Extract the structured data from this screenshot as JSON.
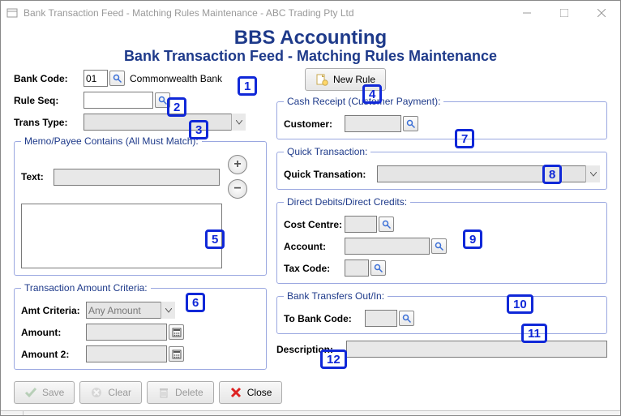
{
  "window": {
    "title": "Bank Transaction Feed - Matching Rules Maintenance - ABC Trading Pty Ltd"
  },
  "headings": {
    "h1": "BBS Accounting",
    "h2": "Bank Transaction Feed - Matching Rules Maintenance"
  },
  "left": {
    "bankCodeLabel": "Bank Code:",
    "bankCodeValue": "01",
    "bankName": "Commonwealth Bank",
    "ruleSeqLabel": "Rule Seq:",
    "transTypeLabel": "Trans Type:",
    "memoLegend": "Memo/Payee Contains (All Must Match):",
    "memoTextLabel": "Text:",
    "amtLegend": "Transaction Amount Criteria:",
    "amtCriteriaLabel": "Amt Criteria:",
    "amtCriteriaValue": "Any Amount",
    "amountLabel": "Amount:",
    "amount2Label": "Amount 2:"
  },
  "right": {
    "newRule": "New Rule",
    "cashLegend": "Cash Receipt (Customer Payment):",
    "customerLabel": "Customer:",
    "quickLegend": "Quick Transaction:",
    "quickLabel": "Quick Transation:",
    "ddLegend": "Direct Debits/Direct Credits:",
    "costCentreLabel": "Cost Centre:",
    "accountLabel": "Account:",
    "taxCodeLabel": "Tax Code:",
    "bankTransLegend": "Bank Transfers Out/In:",
    "toBankLabel": "To Bank Code:",
    "descLabel": "Description:"
  },
  "buttons": {
    "save": "Save",
    "clear": "Clear",
    "delete": "Delete",
    "close": "Close"
  },
  "markers": {
    "m1": "1",
    "m2": "2",
    "m3": "3",
    "m4": "4",
    "m5": "5",
    "m6": "6",
    "m7": "7",
    "m8": "8",
    "m9": "9",
    "m10": "10",
    "m11": "11",
    "m12": "12"
  }
}
